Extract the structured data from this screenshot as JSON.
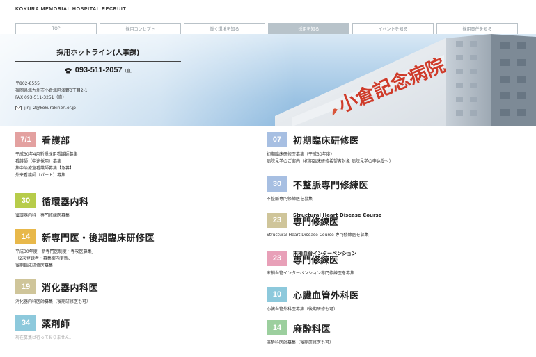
{
  "header": {
    "site_title": "KOKURA MEMORIAL HOSPITAL RECRUIT"
  },
  "nav": {
    "tabs": [
      {
        "label": "TOP"
      },
      {
        "label": "採用コンセプト"
      },
      {
        "label": "働く環境を知る"
      },
      {
        "label": "採用を知る"
      },
      {
        "label": "イベントを知る"
      },
      {
        "label": "採用責任を知る"
      }
    ],
    "active_index": 3
  },
  "hotline": {
    "title": "採用ホットライン(人事課)",
    "phone": "093-511-2057",
    "phone_note": "(直)",
    "postal": "〒802-8555",
    "address": "福岡県北九州市小倉北区浅野3丁目2-1",
    "fax": "FAX 093-511-3251（直）",
    "email": "jinji-2@kokurakinen.or.jp"
  },
  "hero": {
    "sign_text": "小倉記念病院"
  },
  "left_sections": [
    {
      "badge": "7/1",
      "badge_color": "#e3a1a0",
      "title": "看護部",
      "lines": [
        "平成30年4月新規採用看護師募集",
        "看護師（中途採用）募集",
        "集中治療室看護師募集【急募】",
        "外来看護師（パート）募集"
      ]
    },
    {
      "badge": "30",
      "badge_color": "#b7cc4a",
      "title": "循環器内科",
      "lines": [
        "循環器内科　専門修練医募集"
      ]
    },
    {
      "badge": "14",
      "badge_color": "#e8b84a",
      "title": "新専門医・後期臨床研修医",
      "lines": [
        "平成30年度「新専門医制度・専攻医募集」",
        "（2次登録者・募集案内更新、",
        "後期臨床研修医募集"
      ]
    },
    {
      "badge": "19",
      "badge_color": "#cfc59a",
      "title": "消化器内科医",
      "lines": [
        "消化器内科医師募集（後期研修医も可）"
      ]
    },
    {
      "badge": "34",
      "badge_color": "#8dc9dc",
      "title": "薬剤師",
      "lines": [
        "現在募集は行っておりません。"
      ],
      "faint": true
    }
  ],
  "right_sections": [
    {
      "badge": "07",
      "badge_color": "#a7bfe2",
      "title": "初期臨床研修医",
      "lines": [
        "初期臨床研修医募集（平成30年度）",
        "病院見学のご案内（初期臨床研修希望者対象 病院見学の申込受付）"
      ]
    },
    {
      "badge": "30",
      "badge_color": "#a7bfe2",
      "title": "不整脈専門修練医",
      "lines": [
        "不整脈専門修練医を募集"
      ]
    },
    {
      "badge": "23",
      "badge_color": "#cfc59a",
      "title_small": "Structural Heart Disease Course",
      "title": "専門修練医",
      "lines": [
        "Structural Heart Disease Course 専門修練医を募集"
      ]
    },
    {
      "badge": "23",
      "badge_color": "#e8a0b8",
      "title_small": "末梢血管インターベンション",
      "title": "専門修練医",
      "lines": [
        "末梢血管インターベンション専門修練医を募集"
      ]
    },
    {
      "badge": "10",
      "badge_color": "#8dc9dc",
      "title": "心臓血管外科医",
      "lines": [
        "心臓血管外科医募集（後期研修も可）"
      ]
    },
    {
      "badge": "14",
      "badge_color": "#9ccf9e",
      "title": "麻酔科医",
      "lines": [
        "麻酔科医師募集（後期研修医も可）"
      ]
    }
  ]
}
